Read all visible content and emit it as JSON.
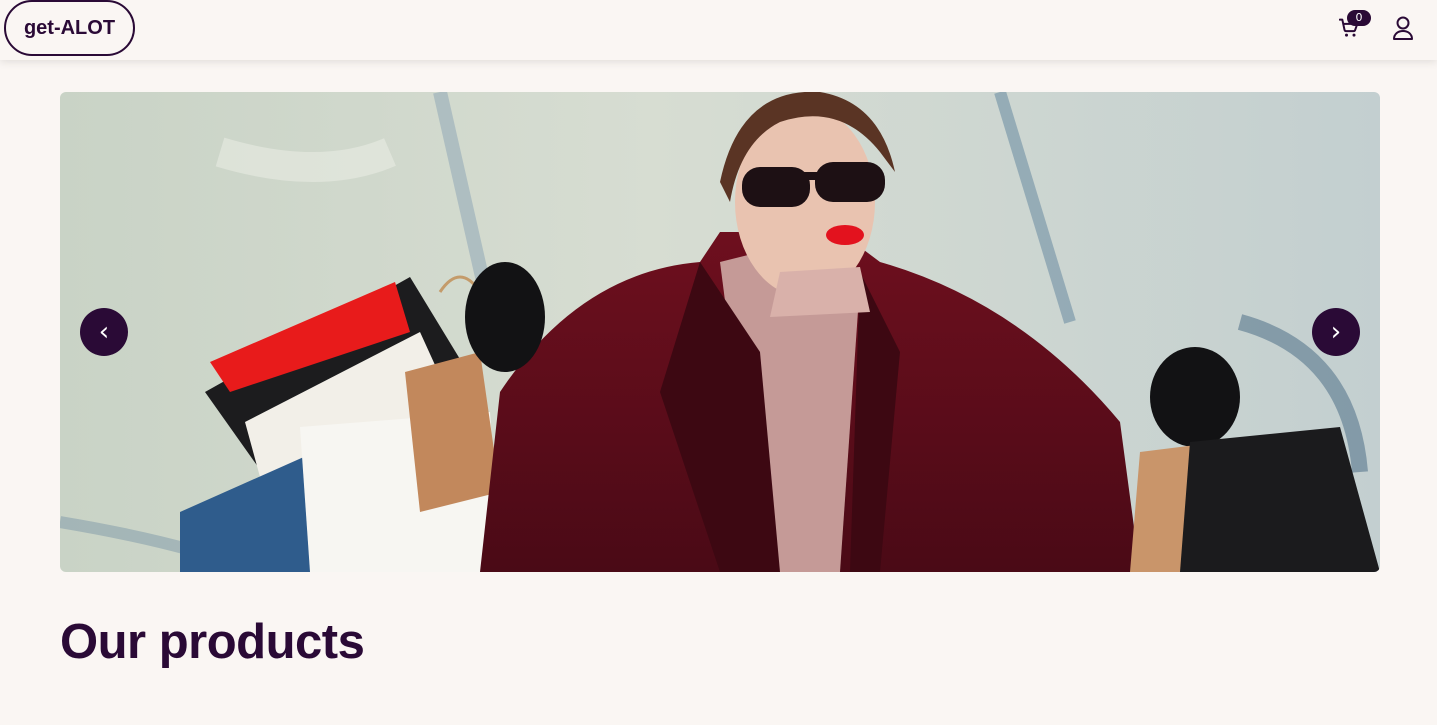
{
  "header": {
    "logo": "get-ALOT",
    "cart_count": "0",
    "cart_icon": "cart-icon",
    "user_icon": "user-icon"
  },
  "carousel": {
    "prev_label": "‹",
    "next_label": "›",
    "image_description_icon": "hero-image"
  },
  "main": {
    "section_title": "Our products"
  },
  "colors": {
    "brand": "#2a0a36",
    "background": "#faf6f3"
  }
}
